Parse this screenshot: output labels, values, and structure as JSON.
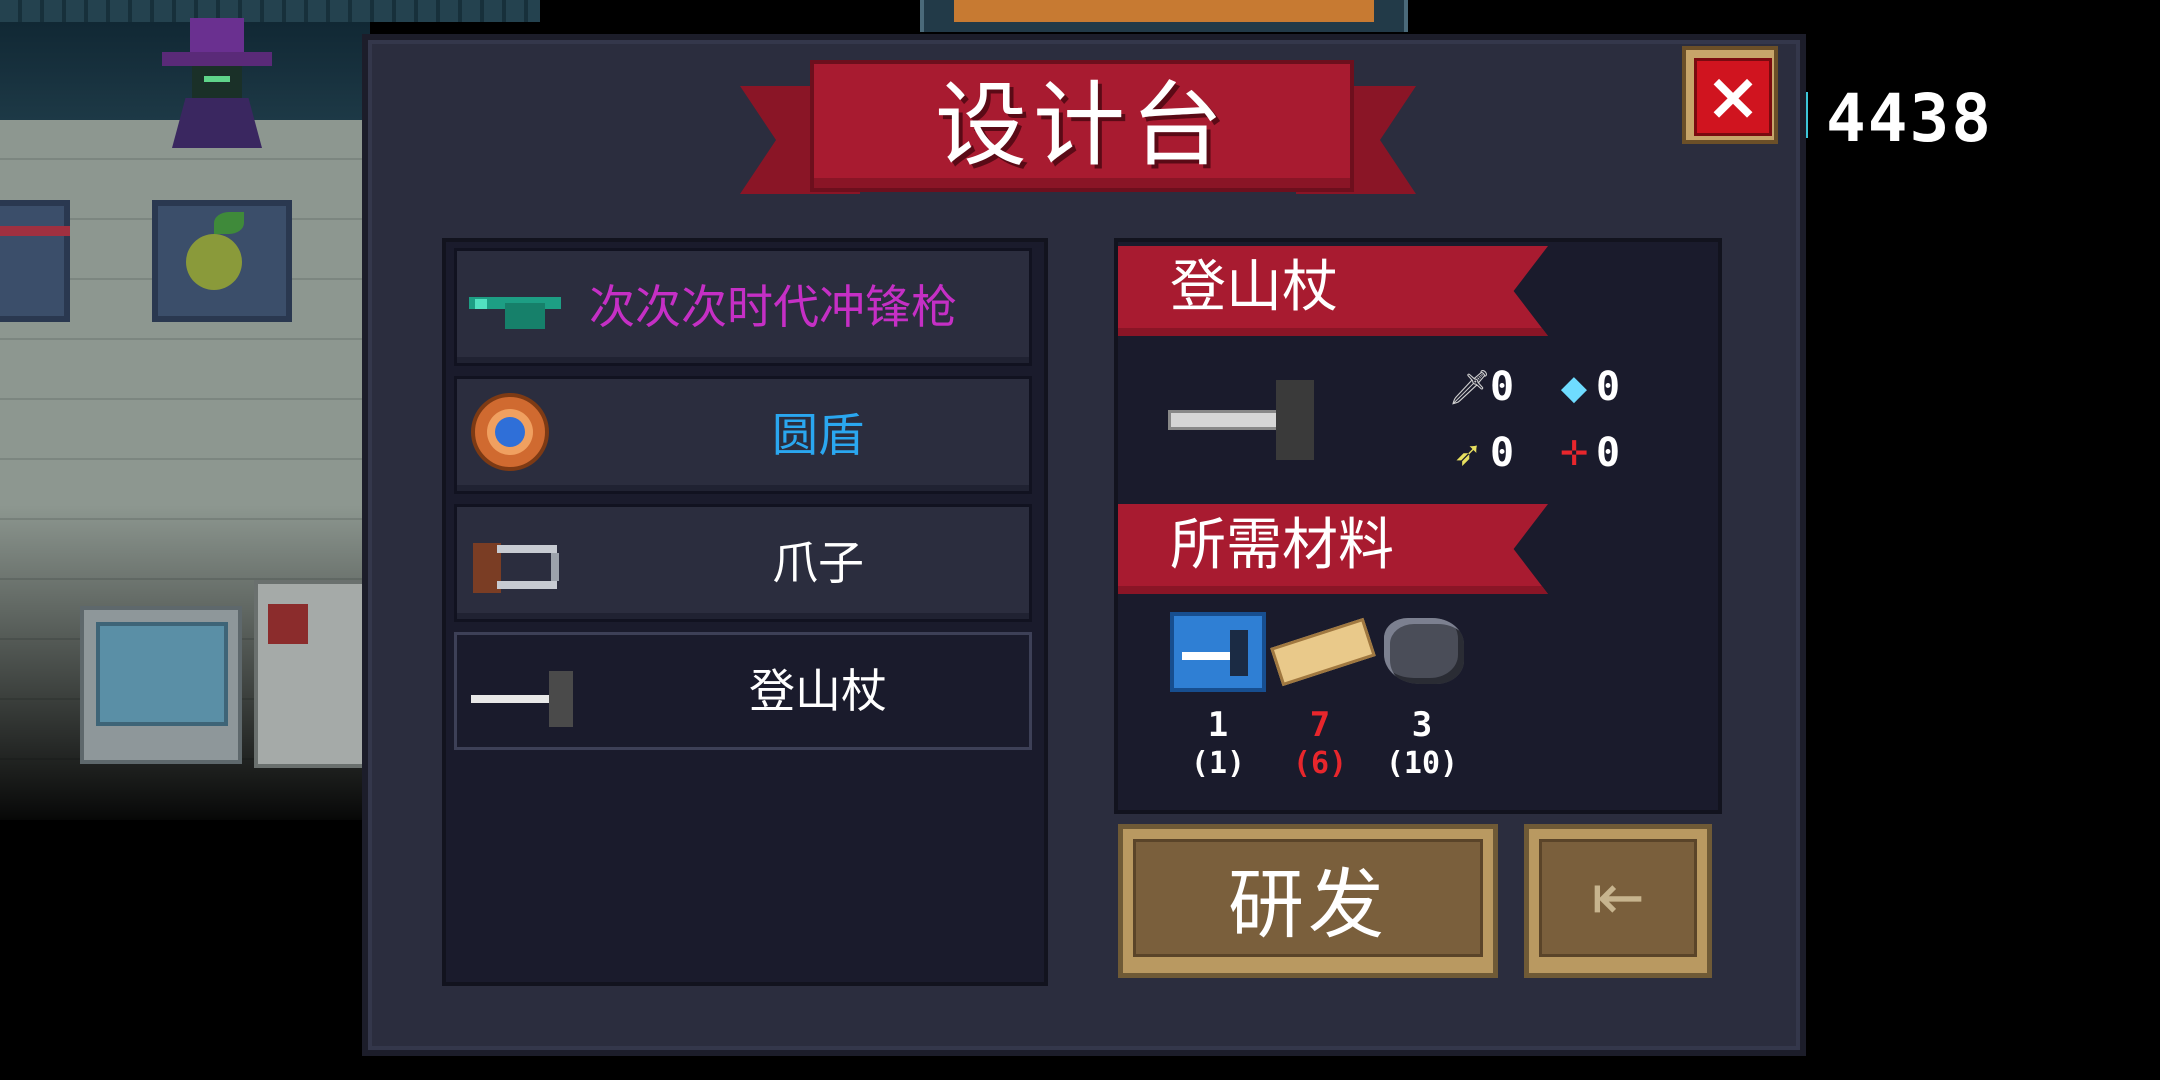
{
  "hud": {
    "coins": "4438"
  },
  "dialog": {
    "title": "设计台",
    "close_icon": "×",
    "list": [
      {
        "label": "次次次时代冲锋枪",
        "color": "#c52fc5",
        "icon": "smg-icon"
      },
      {
        "label": "圆盾",
        "color": "#2aa7f0",
        "icon": "round-shield-icon"
      },
      {
        "label": "爪子",
        "color": "#ffffff",
        "icon": "claw-icon"
      },
      {
        "label": "登山杖",
        "color": "#ffffff",
        "icon": "hammer-icon",
        "selected": true
      }
    ],
    "detail": {
      "name": "登山杖",
      "stats": {
        "attack": {
          "icon": "sword-icon",
          "value": "0"
        },
        "energy": {
          "icon": "diamond-icon",
          "value": "0"
        },
        "crit": {
          "icon": "feather-icon",
          "value": "0"
        },
        "accuracy": {
          "icon": "crosshair-icon",
          "value": "0"
        }
      },
      "materials_title": "所需材料",
      "materials": [
        {
          "icon": "blueprint-icon",
          "have": "1",
          "need": "(1)",
          "enough": true
        },
        {
          "icon": "wood-icon",
          "have": "7",
          "need": "(6)",
          "enough": false
        },
        {
          "icon": "ore-icon",
          "have": "3",
          "need": "(10)",
          "enough": true
        }
      ]
    },
    "research_button": "研发",
    "exit_icon": "⇤"
  },
  "colors": {
    "ribbon": "#a81b30",
    "panel": "#1a1b2c",
    "button": "#7a5f3c",
    "insufficient": "#e8262c"
  }
}
